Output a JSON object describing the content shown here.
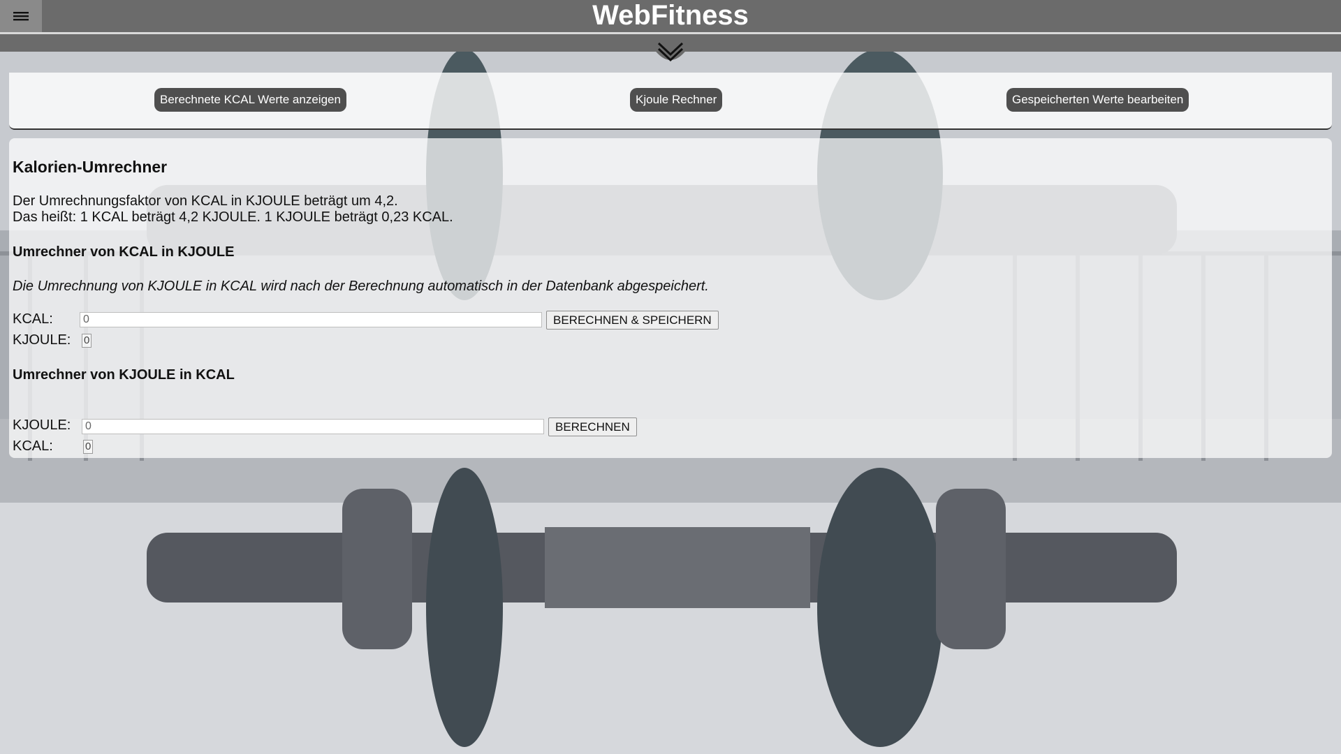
{
  "header": {
    "title": "WebFitness",
    "menu_icon": "hamburger-menu-icon",
    "expand_icon": "double-chevron-down-icon"
  },
  "nav": {
    "show_kcal_values": "Berechnete KCAL Werte anzeigen",
    "kjoule_calculator": "Kjoule Rechner",
    "edit_saved_values": "Gespeicherten Werte bearbeiten"
  },
  "converter": {
    "title": "Kalorien-Umrechner",
    "info_line_1": "Der Umrechnungsfaktor von KCAL in KJOULE beträgt um 4,2.",
    "info_line_2": "Das heißt: 1 KCAL beträgt 4,2 KJOULE. 1 KJOULE beträgt 0,23 KCAL.",
    "kcal_to_kjoule": {
      "title": "Umrechner von KCAL in KJOULE",
      "note": "Die Umrechnung von KJOULE in KCAL wird nach der Berechnung automatisch in der Datenbank abgespeichert.",
      "input_label": "KCAL:",
      "input_value": "0",
      "button_label": "BERECHNEN & SPEICHERN",
      "output_label": "KJOULE:",
      "output_value": "0"
    },
    "kjoule_to_kcal": {
      "title": "Umrechner von KJOULE in KCAL",
      "input_label": "KJOULE:",
      "input_value": "0",
      "button_label": "BERECHNEN",
      "output_label": "KCAL:",
      "output_value": "0"
    }
  },
  "colors": {
    "header_bg": "#6b6b6b",
    "nav_button_bg": "#4f4f4f"
  }
}
